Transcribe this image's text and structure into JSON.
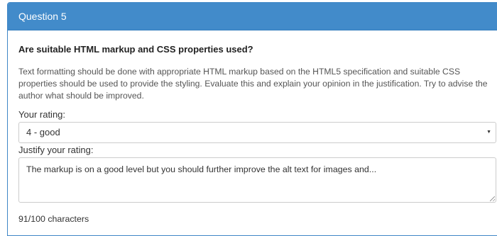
{
  "panel": {
    "heading": "Question 5"
  },
  "question": {
    "title": "Are suitable HTML markup and CSS properties used?",
    "description": "Text formatting should be done with appropriate HTML markup based on the HTML5 specification and suitable CSS properties should be used to provide the styling. Evaluate this and explain your opinion in the justification. Try to advise the author what should be improved."
  },
  "rating": {
    "label": "Your rating:",
    "selected": "4 - good",
    "caret_icon": "caret-down-icon"
  },
  "justification": {
    "label": "Justify your rating:",
    "value": "The markup is on a good level but you should further improve the alt text for images and...",
    "char_count_text": "91/100 characters"
  },
  "colors": {
    "heading_bg": "#428bca",
    "heading_text": "#ffffff",
    "border": "#cccccc"
  }
}
